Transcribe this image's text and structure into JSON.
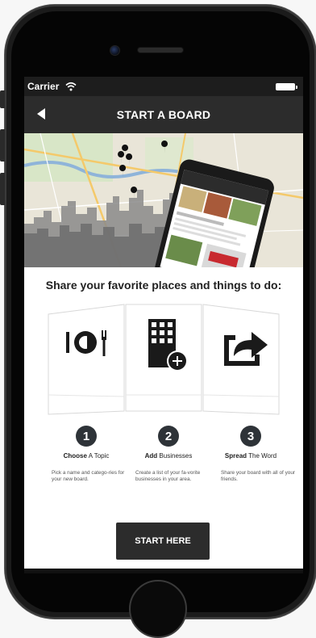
{
  "status_bar": {
    "carrier": "Carrier"
  },
  "nav": {
    "title": "START A BOARD",
    "back_icon": "back-arrow-icon"
  },
  "headline": "Share your favorite places and things to do:",
  "steps": [
    {
      "number": "1",
      "title_bold": "Choose",
      "title_rest": " A Topic",
      "desc": "Pick a name and catego-ries for your new board.",
      "icon": "plate-fork-knife-icon"
    },
    {
      "number": "2",
      "title_bold": "Add",
      "title_rest": " Businesses",
      "desc": "Create a list of your fa-vorite businesses in your area.",
      "icon": "building-add-icon"
    },
    {
      "number": "3",
      "title_bold": "Spread",
      "title_rest": " The Word",
      "desc": "Share your board with all of your friends.",
      "icon": "share-arrow-icon"
    }
  ],
  "cta": {
    "label": "START HERE"
  },
  "colors": {
    "dark": "#2c2c2c",
    "step_circle": "#2e3338",
    "farm_sign": "#c8292f"
  }
}
